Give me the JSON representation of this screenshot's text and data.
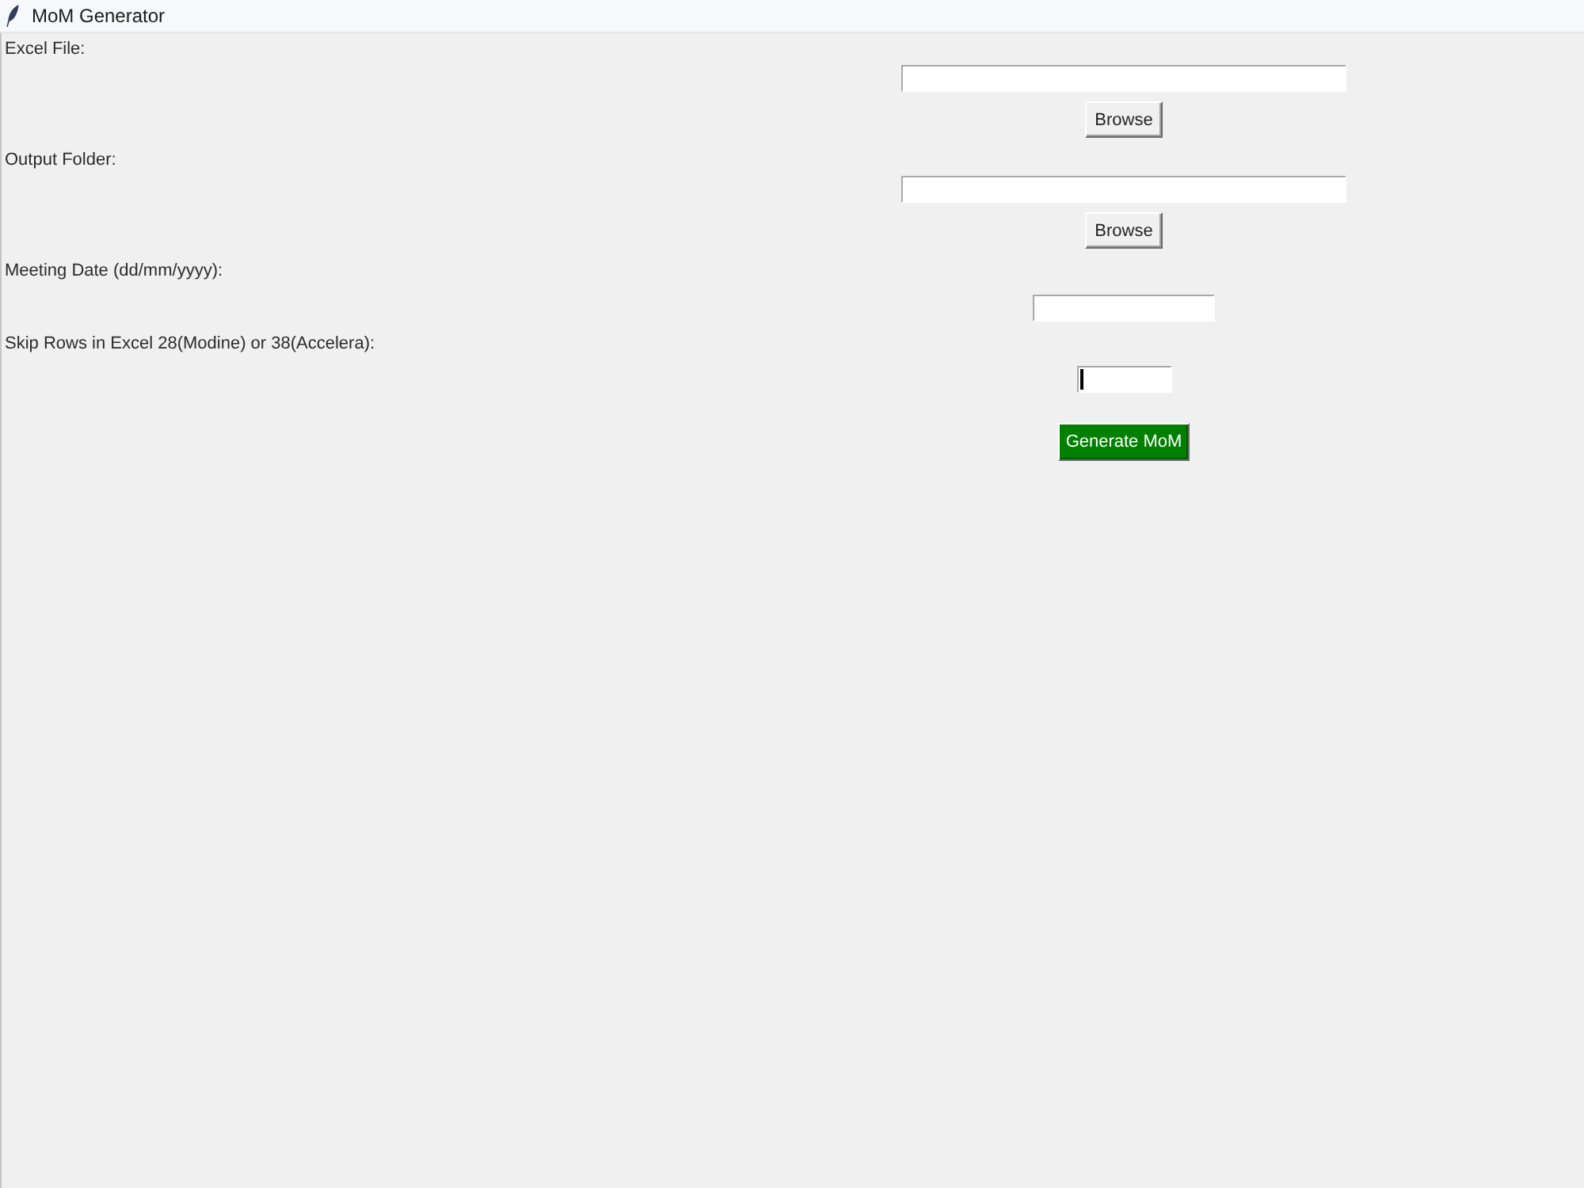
{
  "window": {
    "title": "MoM Generator"
  },
  "fields": [
    {
      "kind": "path",
      "label": "Excel File:",
      "focused": false,
      "button": "Browse"
    },
    {
      "kind": "path",
      "label": "Output Folder:",
      "focused": false,
      "button": "Browse"
    },
    {
      "kind": "date",
      "label": "Meeting Date (dd/mm/yyyy):",
      "focused": false
    },
    {
      "kind": "number",
      "label": "Skip Rows in Excel 28(Modine) or 38(Accelera):",
      "focused": true
    }
  ],
  "submit_button": {
    "label": "Generate MoM"
  }
}
